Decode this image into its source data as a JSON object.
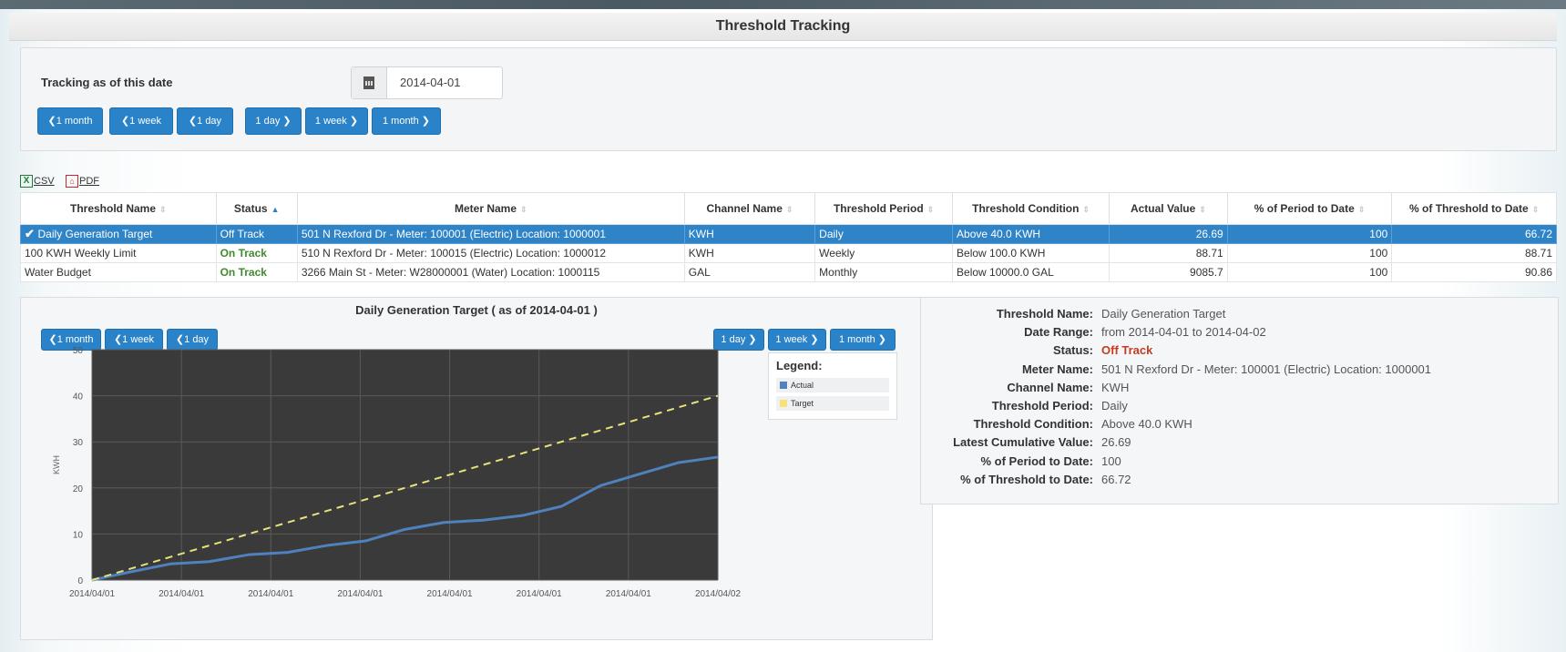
{
  "page": {
    "title": "Threshold Tracking"
  },
  "tracking": {
    "label": "Tracking as of this date",
    "date": "2014-04-01",
    "nav": {
      "back_month": "❮1 month",
      "back_week": "❮1 week",
      "back_day": "❮1 day",
      "fwd_day": "1 day ❯",
      "fwd_week": "1 week ❯",
      "fwd_month": "1 month ❯"
    }
  },
  "export": {
    "csv": "CSV",
    "pdf": "PDF"
  },
  "table": {
    "headers": [
      "Threshold Name",
      "Status",
      "Meter Name",
      "Channel Name",
      "Threshold Period",
      "Threshold Condition",
      "Actual Value",
      "% of Period to Date",
      "% of Threshold to Date"
    ],
    "rows": [
      {
        "name": "Daily Generation Target",
        "status": "Off Track",
        "meter": "501 N Rexford Dr - Meter: 100001 (Electric) Location: 1000001",
        "channel": "KWH",
        "period": "Daily",
        "condition": "Above 40.0 KWH",
        "actual": "26.69",
        "pct_period": "100",
        "pct_threshold": "66.72"
      },
      {
        "name": "100 KWH Weekly Limit",
        "status": "On Track",
        "meter": "510 N Rexford Dr - Meter: 100015 (Electric) Location: 1000012",
        "channel": "KWH",
        "period": "Weekly",
        "condition": "Below 100.0 KWH",
        "actual": "88.71",
        "pct_period": "100",
        "pct_threshold": "88.71"
      },
      {
        "name": "Water Budget",
        "status": "On Track",
        "meter": "3266 Main St - Meter: W28000001 (Water) Location: 1000115",
        "channel": "GAL",
        "period": "Monthly",
        "condition": "Below 10000.0 GAL",
        "actual": "9085.7",
        "pct_period": "100",
        "pct_threshold": "90.86"
      }
    ]
  },
  "chart_panel": {
    "title": "Daily Generation Target ( as of 2014-04-01 )",
    "nav": {
      "back_month": "❮1 month",
      "back_week": "❮1 week",
      "back_day": "❮1 day",
      "fwd_day": "1 day ❯",
      "fwd_week": "1 week ❯",
      "fwd_month": "1 month ❯"
    },
    "legend": {
      "title": "Legend:",
      "actual": "Actual",
      "target": "Target"
    }
  },
  "chart_data": {
    "type": "line",
    "title": "Daily Generation Target ( as of 2014-04-01 )",
    "xlabel": "",
    "ylabel": "KWH",
    "ylim": [
      0,
      50
    ],
    "yticks": [
      0,
      10,
      20,
      30,
      40,
      50
    ],
    "x_tick_labels": [
      "2014/04/01",
      "2014/04/01",
      "2014/04/01",
      "2014/04/01",
      "2014/04/01",
      "2014/04/01",
      "2014/04/01",
      "2014/04/02"
    ],
    "x_hours": [
      0,
      1.5,
      3,
      4.5,
      6,
      7.5,
      9,
      10.5,
      12,
      13.5,
      15,
      16.5,
      18,
      19.5,
      21,
      22.5,
      24
    ],
    "grid": true,
    "legend_position": "top-right",
    "colors": {
      "actual": "#4f81bd",
      "target": "#e8e27a",
      "plot_bg": "#3a3a3a"
    },
    "series": [
      {
        "name": "Actual",
        "values": [
          0,
          1.8,
          3.5,
          4.0,
          5.5,
          6.0,
          7.5,
          8.5,
          11.0,
          12.5,
          13.0,
          14.0,
          16.0,
          20.5,
          23.0,
          25.5,
          26.69
        ]
      },
      {
        "name": "Target",
        "values": [
          0,
          2.5,
          5.0,
          7.5,
          10.0,
          12.5,
          15.0,
          17.5,
          20.0,
          22.5,
          25.0,
          27.5,
          30.0,
          32.5,
          35.0,
          37.5,
          40.0
        ]
      }
    ]
  },
  "details": {
    "rows": [
      {
        "label": "Threshold Name:",
        "value": "Daily Generation Target"
      },
      {
        "label": "Date Range:",
        "value": "from 2014-04-01 to 2014-04-02"
      },
      {
        "label": "Status:",
        "value": "Off Track"
      },
      {
        "label": "Meter Name:",
        "value": "501 N Rexford Dr - Meter: 100001 (Electric) Location: 1000001"
      },
      {
        "label": "Channel Name:",
        "value": "KWH"
      },
      {
        "label": "Threshold Period:",
        "value": "Daily"
      },
      {
        "label": "Threshold Condition:",
        "value": "Above 40.0 KWH"
      },
      {
        "label": "Latest Cumulative Value:",
        "value": "26.69"
      },
      {
        "label": "% of Period to Date:",
        "value": "100"
      },
      {
        "label": "% of Threshold to Date:",
        "value": "66.72"
      }
    ]
  }
}
